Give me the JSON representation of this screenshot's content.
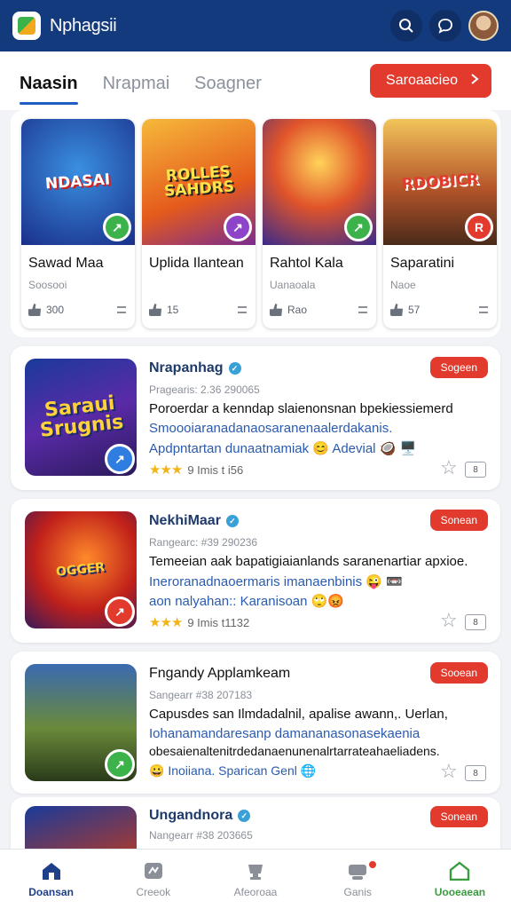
{
  "header": {
    "app_title": "Nphagsii",
    "icons": [
      "app-logo-icon",
      "search-icon",
      "chat-icon",
      "avatar"
    ]
  },
  "tabs": [
    {
      "label": "Naasin",
      "active": true
    },
    {
      "label": "Nrapmai",
      "active": false
    },
    {
      "label": "Soagner",
      "active": false
    }
  ],
  "cta": {
    "label": "Saroaacieo",
    "icon": "chevron-right-icon"
  },
  "featured": [
    {
      "art_text": "NDASAI",
      "name": "Sawad Maa",
      "sub": "Soosooi",
      "count": "300",
      "badge_color": "#3cb24a",
      "badge_icon": "↗"
    },
    {
      "art_text": "ROLLES SAHDRS",
      "name": "Uplida Ilantean",
      "sub": "",
      "count": "15",
      "badge_color": "#8e44c9",
      "badge_icon": "↗"
    },
    {
      "art_text": "",
      "name": "Rahtol Kala",
      "sub": "Uanaoala",
      "count": "Rao",
      "badge_color": "#3cb24a",
      "badge_icon": "↗"
    },
    {
      "art_text": "RDOBICR",
      "name": "Saparatini",
      "sub": "Naoe",
      "count": "57",
      "badge_color": "#e23b2e",
      "badge_icon": "R"
    }
  ],
  "games": [
    {
      "art_text": "Saraui Srugnis",
      "title": "Nrapanhag",
      "meta": "Pragearis: 2.36 290065",
      "line1": "Poroerdar a kenndap slaienonsnan bpekiessiemerd",
      "line2": "Smoooiaranadanaosaranenaalerdakanis.",
      "line3": "Apdpntartan dunaatnamiak 😊 Adevial 🥥 🖥️",
      "rating": "9 Imis t i56",
      "pill": "Sogeen",
      "box": "8",
      "badge_color": "#2f7de1",
      "badge_icon": "↗"
    },
    {
      "art_text": "OGGER",
      "title": "NekhiMaar",
      "meta": "Rangearc: #39 290236",
      "line1": "Temeeian aak bapatigiaianlands saranenartiar apxioe.",
      "line2": "Ineroranadnaoermaris imanaenbinis 😜 📼",
      "line3": "aon nalyahan:: Karanisoan 🙄😡",
      "rating": "9 Imis t1132",
      "pill": "Sonean",
      "box": "8",
      "badge_color": "#e23b2e",
      "badge_icon": "↗"
    },
    {
      "art_text": "",
      "title": "Fngandy Applamkeam",
      "meta": "Sangearr #38 207183",
      "line1": "Capusdes san Ilmdadalnil, apalise awann,. Uerlan,",
      "line2": "Iohanamandaresanp damananasonasekaenia",
      "line3": "obesaienaltenitrdedanaenunenalrtarrateahaeliadens.",
      "line4": "😀 Inoiiana. Sparican Genl 🌐",
      "pill": "Sooean",
      "box": "8",
      "badge_color": "#3cb24a",
      "badge_icon": "↗"
    },
    {
      "art_text": "",
      "title": "Ungandnora",
      "meta": "Nangearr #38 203665",
      "pill": "Sonean",
      "badge_color": "#2f7de1"
    }
  ],
  "bottom_nav": [
    {
      "label": "Doansan",
      "icon": "home-icon",
      "state": "active-home"
    },
    {
      "label": "Creeok",
      "icon": "gamepad-icon",
      "state": ""
    },
    {
      "label": "Afeoroaa",
      "icon": "trophy-icon",
      "state": ""
    },
    {
      "label": "Ganis",
      "icon": "profile-icon",
      "state": "",
      "dot": true
    },
    {
      "label": "Uooeaean",
      "icon": "house-outline-icon",
      "state": "active-green"
    }
  ]
}
